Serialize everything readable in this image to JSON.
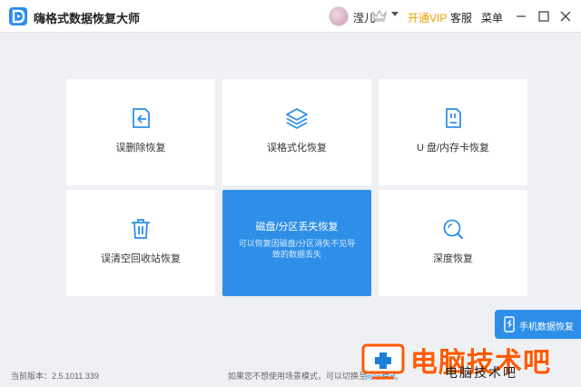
{
  "app": {
    "title": "嗨格式数据恢复大师"
  },
  "header": {
    "username": "滢儿",
    "vip_label": "开通VIP",
    "service_label": "客服",
    "menu_label": "菜单"
  },
  "colors": {
    "accent": "#2f8fe8",
    "vip": "#e8a000",
    "watermark": "#ff5a00"
  },
  "cards": [
    {
      "label": "误删除恢复",
      "icon": "file-restore-icon"
    },
    {
      "label": "误格式化恢复",
      "icon": "layers-icon"
    },
    {
      "label": "U 盘/内存卡恢复",
      "icon": "sd-card-icon"
    },
    {
      "label": "误清空回收站恢复",
      "icon": "trash-icon"
    },
    {
      "label": "磁盘/分区丢失恢复",
      "desc": "可以恢复因磁盘/分区消失不见导致的数据丢失",
      "active": true
    },
    {
      "label": "深度恢复",
      "icon": "search-icon"
    }
  ],
  "phone_tab": {
    "label": "手机数据恢复"
  },
  "footer": {
    "version": "当前版本：2.5.1011.339",
    "tip": "如果您不想使用场景模式，可以切换至",
    "tip_link": "向导模式"
  },
  "watermark": {
    "text": "电脑技术吧",
    "sub": "电脑技术吧"
  }
}
